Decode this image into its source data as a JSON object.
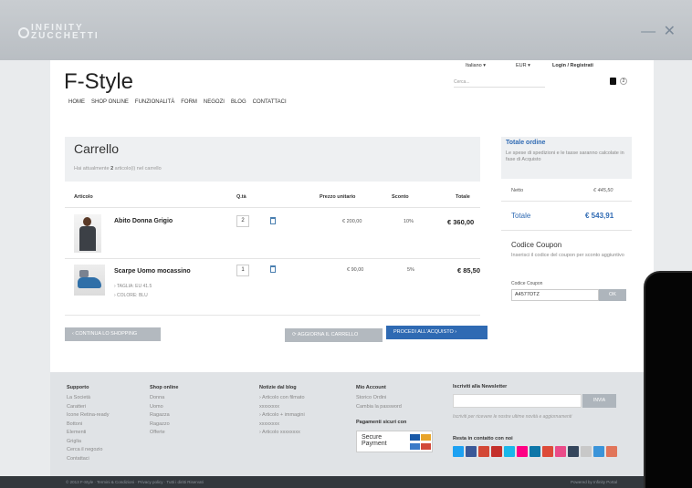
{
  "brand": {
    "line1": "INFINITY",
    "line2": "ZUCCHETTI"
  },
  "window": {
    "minimize": "—",
    "close": "✕"
  },
  "site": {
    "logo": "F-Style",
    "nav": [
      "HOME",
      "SHOP ONLINE",
      "FUNZIONALITÀ",
      "FORM",
      "NEGOZI",
      "BLOG",
      "CONTATTACI"
    ],
    "language": "Italiano ▾",
    "currency": "EUR ▾",
    "login": "Login / Registrati",
    "search_placeholder": "Cerca...",
    "cart_count": "2"
  },
  "cart": {
    "title": "Carrello",
    "subtitle_pre": "Hai attualmente ",
    "subtitle_count": "2",
    "subtitle_post": " articolo(i) nel carrello",
    "headers": {
      "article": "Articolo",
      "qty": "Q.tà",
      "unit_price": "Prezzo unitario",
      "discount": "Sconto",
      "total": "Totale"
    },
    "items": [
      {
        "name": "Abito Donna Grigio",
        "qty": "2",
        "unit_price": "€ 200,00",
        "discount": "10%",
        "total": "€ 360,00",
        "attrs": []
      },
      {
        "name": "Scarpe Uomo mocassino",
        "qty": "1",
        "unit_price": "€ 90,00",
        "discount": "5%",
        "total": "€ 85,50",
        "attrs": [
          "› TAGLIA: EU 41.5",
          "› COLORE: BLU"
        ]
      }
    ],
    "btn_continue": "‹  CONTINUA LO SHOPPING",
    "btn_update": "⟳  AGGIORNA IL CARRELLO",
    "btn_checkout": "PROCEDI ALL'ACQUISTO  ›"
  },
  "summary": {
    "title": "Totale ordine",
    "desc": "Le spese di spedizioni e le tasse saranno calcolate in fase di Acquisto",
    "netto_label": "Netto",
    "netto_value": "€ 445,50",
    "total_label": "Totale",
    "total_value": "€ 543,91",
    "coupon_title": "Codice Coupon",
    "coupon_desc": "Inserisci il codice del coupon per sconto aggiuntivo",
    "coupon_label": "Codice Coupon",
    "coupon_value": "A4577OTZ",
    "coupon_btn": "OK"
  },
  "footer": {
    "col1": {
      "title": "Supporto",
      "items": [
        "La Società",
        "Caratteri",
        "Icone Retina-ready",
        "Bottoni",
        "Elementi",
        "Griglia",
        "Cerca il negozio",
        "Contattaci"
      ]
    },
    "col2": {
      "title": "Shop online",
      "items": [
        "Donna",
        "Uomo",
        "Ragazza",
        "Ragazzo",
        "Offerte"
      ]
    },
    "col3": {
      "title": "Notizie dal blog",
      "items": [
        "› Articolo con filmato",
        "xxxxxxxx",
        "› Articolo + immagini",
        "xxxxxxxx",
        "› Articolo  xxxxxxxx"
      ]
    },
    "col4": {
      "title": "Mio Account",
      "items": [
        "Storico Ordini",
        "Cambia la password"
      ]
    },
    "payments_title": "Pagamenti sicuri con",
    "secure_text1": "Secure",
    "secure_text2": "Payment",
    "newsletter_title": "Iscriviti alla Newsletter",
    "newsletter_btn": "INVIA",
    "newsletter_note": "Iscriviti per ricevere le nostre ultime novità e aggiornamenti",
    "social_title": "Resta in contatto con noi",
    "social_colors": [
      "#1da1f2",
      "#3b5998",
      "#d34836",
      "#c4302b",
      "#1ab7ea",
      "#ff0084",
      "#0e76a8",
      "#dd4b39",
      "#ea4c89",
      "#35465c",
      "#c8c8c8",
      "#3b94d9",
      "#e1755a"
    ]
  },
  "bottom": {
    "left": "© 2013 F-Style · Termini & Condizioni · Privacy policy · Tutti i diritti Riservati",
    "right": "Powered by Infinity Portal"
  }
}
